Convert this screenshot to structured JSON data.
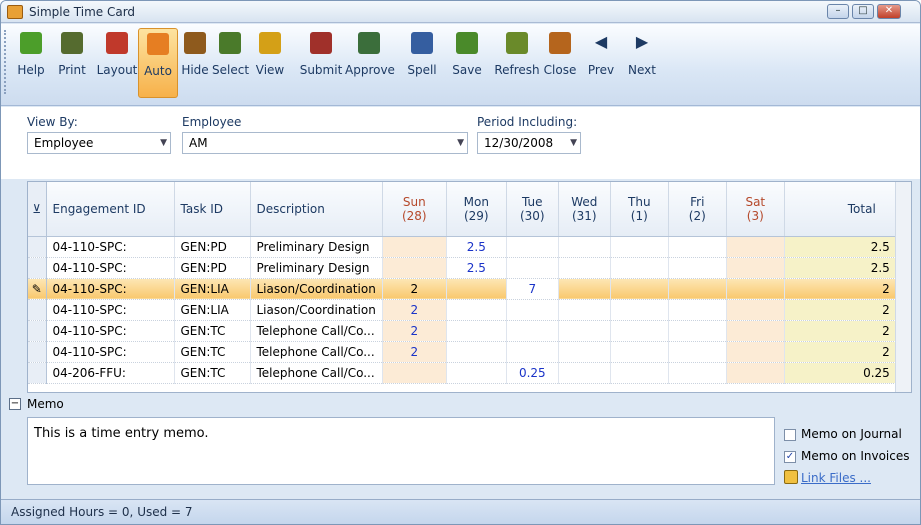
{
  "window": {
    "title": "Simple Time Card",
    "min": "–",
    "max": "□",
    "close": "✕"
  },
  "toolbar": [
    {
      "label": "Help",
      "icon": "help-icon",
      "color": "#4c9e2a"
    },
    {
      "label": "Print",
      "icon": "print-icon",
      "color": "#556b2f"
    },
    {
      "label": "Layout",
      "icon": "layout-icon",
      "color": "#c0392b"
    },
    {
      "label": "Auto",
      "icon": "auto-icon",
      "color": "#e67e22"
    },
    {
      "label": "Hide",
      "icon": "hide-icon",
      "color": "#8e5a1d"
    },
    {
      "label": "Select",
      "icon": "select-icon",
      "color": "#4a7a2a"
    },
    {
      "label": "View",
      "icon": "view-icon",
      "color": "#d4a017"
    },
    {
      "label": "Submit",
      "icon": "submit-icon",
      "color": "#a0302a"
    },
    {
      "label": "Approve",
      "icon": "approve-icon",
      "color": "#3b6e3b"
    },
    {
      "label": "Spell",
      "icon": "spell-icon",
      "color": "#355ea0"
    },
    {
      "label": "Save",
      "icon": "save-icon",
      "color": "#4a8a2a"
    },
    {
      "label": "Refresh",
      "icon": "refresh-icon",
      "color": "#6a8a2a"
    },
    {
      "label": "Close",
      "icon": "close-door-icon",
      "color": "#b5651d"
    },
    {
      "label": "Prev",
      "icon": "prev-arrow-icon",
      "color": "#333333"
    },
    {
      "label": "Next",
      "icon": "next-arrow-icon",
      "color": "#333333"
    }
  ],
  "filters": {
    "view_by_label": "View By:",
    "view_by_value": "Employee",
    "employee_label": "Employee",
    "employee_value": "AM",
    "period_label": "Period Including:",
    "period_value": "12/30/2008"
  },
  "grid": {
    "columns": [
      {
        "key": "eng",
        "label": "Engagement ID"
      },
      {
        "key": "task",
        "label": "Task ID"
      },
      {
        "key": "desc",
        "label": "Description"
      },
      {
        "key": "sun",
        "label": "Sun",
        "sub": "(28)"
      },
      {
        "key": "mon",
        "label": "Mon",
        "sub": "(29)"
      },
      {
        "key": "tue",
        "label": "Tue",
        "sub": "(30)"
      },
      {
        "key": "wed",
        "label": "Wed",
        "sub": "(31)"
      },
      {
        "key": "thu",
        "label": "Thu",
        "sub": "(1)"
      },
      {
        "key": "fri",
        "label": "Fri",
        "sub": "(2)"
      },
      {
        "key": "sat",
        "label": "Sat",
        "sub": "(3)"
      },
      {
        "key": "total",
        "label": "Total"
      }
    ],
    "rows": [
      {
        "eng": "04-110-SPC:",
        "task": "GEN:PD",
        "desc": "Preliminary Design",
        "sun": "",
        "mon": "2.5",
        "tue": "",
        "wed": "",
        "thu": "",
        "fri": "",
        "sat": "",
        "total": "2.5"
      },
      {
        "eng": "04-110-SPC:",
        "task": "GEN:PD",
        "desc": "Preliminary Design",
        "sun": "",
        "mon": "2.5",
        "tue": "",
        "wed": "",
        "thu": "",
        "fri": "",
        "sat": "",
        "total": "2.5"
      },
      {
        "eng": "04-110-SPC:",
        "task": "GEN:LIA",
        "desc": "Liason/Coordination",
        "sun": "2",
        "mon": "",
        "tue": "7",
        "wed": "",
        "thu": "",
        "fri": "",
        "sat": "",
        "total": "2",
        "current": true
      },
      {
        "eng": "04-110-SPC:",
        "task": "GEN:LIA",
        "desc": "Liason/Coordination",
        "sun": "2",
        "mon": "",
        "tue": "",
        "wed": "",
        "thu": "",
        "fri": "",
        "sat": "",
        "total": "2"
      },
      {
        "eng": "04-110-SPC:",
        "task": "GEN:TC",
        "desc": "Telephone Call/Co...",
        "sun": "2",
        "mon": "",
        "tue": "",
        "wed": "",
        "thu": "",
        "fri": "",
        "sat": "",
        "total": "2"
      },
      {
        "eng": "04-110-SPC:",
        "task": "GEN:TC",
        "desc": "Telephone Call/Co...",
        "sun": "2",
        "mon": "",
        "tue": "",
        "wed": "",
        "thu": "",
        "fri": "",
        "sat": "",
        "total": "2"
      },
      {
        "eng": "04-206-FFU:",
        "task": "GEN:TC",
        "desc": "Telephone Call/Co...",
        "sun": "",
        "mon": "",
        "tue": "0.25",
        "wed": "",
        "thu": "",
        "fri": "",
        "sat": "",
        "total": "0.25"
      }
    ]
  },
  "memo": {
    "header": "Memo",
    "text": "This is a time entry memo.",
    "journal_label": "Memo on Journal",
    "journal_checked": false,
    "invoices_label": "Memo on Invoices",
    "invoices_checked": true,
    "link_label": "Link Files ..."
  },
  "status": {
    "text": "Assigned Hours = 0,  Used = 7"
  }
}
